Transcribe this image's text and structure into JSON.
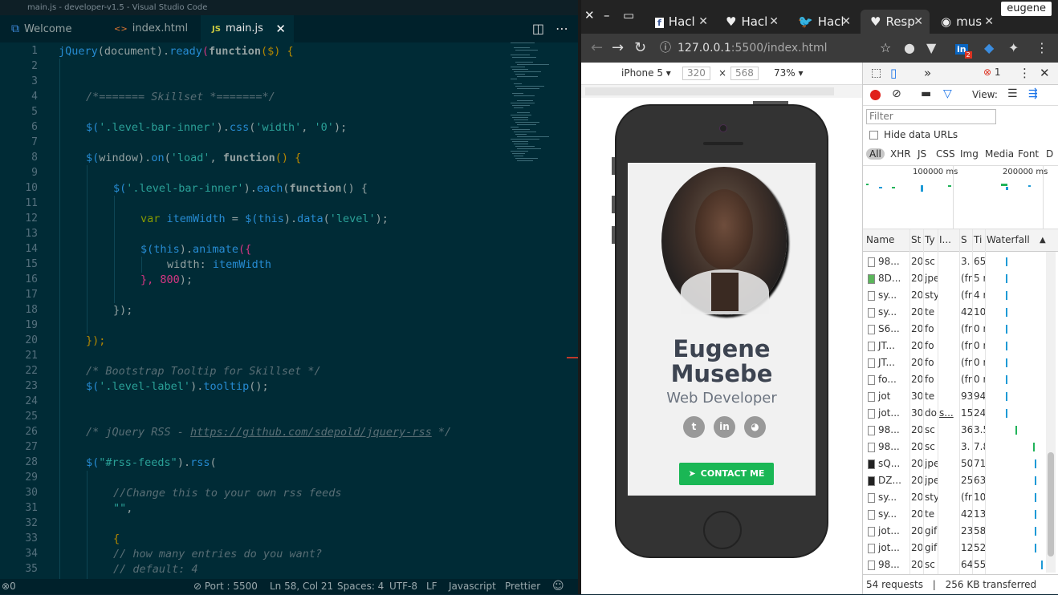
{
  "vscode": {
    "window_title": "main.js - developer-v1.5 - Visual Studio Code",
    "tabs": [
      {
        "label": "Welcome",
        "icon": "vscode-icon"
      },
      {
        "label": "index.html",
        "icon": "html-icon"
      },
      {
        "label": "main.js",
        "icon": "js-icon",
        "active": true
      }
    ],
    "line_numbers": [
      "1",
      "2",
      "3",
      "4",
      "5",
      "6",
      "7",
      "8",
      "9",
      "10",
      "11",
      "12",
      "13",
      "14",
      "15",
      "16",
      "17",
      "18",
      "19",
      "20",
      "21",
      "22",
      "23",
      "24",
      "25",
      "26",
      "27",
      "28",
      "29",
      "30",
      "31",
      "32",
      "33",
      "34",
      "35"
    ],
    "status": {
      "errors": "0",
      "port": "Port : 5500",
      "position": "Ln 58, Col 21",
      "spaces": "Spaces: 4",
      "encoding": "UTF-8",
      "eol": "LF",
      "language": "Javascript",
      "formatter": "Prettier"
    },
    "code": {
      "l1a": "jQuery",
      "l1b": "(document).",
      "l1c": "ready",
      "l1d": "(",
      "l1e": "function",
      "l1f": "($) {",
      "l4": "/*======= Skillset *=======*/",
      "l6a": "$(",
      "l6b": "'.level-bar-inner'",
      "l6c": ").",
      "l6d": "css",
      "l6e": "(",
      "l6f": "'width'",
      "l6g": ", ",
      "l6h": "'0'",
      "l6i": ");",
      "l8a": "$(",
      "l8b": "window",
      "l8c": ").",
      "l8d": "on",
      "l8e": "(",
      "l8f": "'load'",
      "l8g": ", ",
      "l8h": "function",
      "l8i": "() {",
      "l10a": "$(",
      "l10b": "'.level-bar-inner'",
      "l10c": ").",
      "l10d": "each",
      "l10e": "(",
      "l10f": "function",
      "l10g": "() {",
      "l12a": "var ",
      "l12b": "itemWidth",
      "l12c": " = ",
      "l12d": "$(",
      "l12e": "this",
      "l12f": ").",
      "l12g": "data",
      "l12h": "(",
      "l12i": "'level'",
      "l12j": ");",
      "l14a": "$(",
      "l14b": "this",
      "l14c": ").",
      "l14d": "animate",
      "l14e": "({",
      "l15a": "width: ",
      "l15b": "itemWidth",
      "l16a": "}, ",
      "l16b": "800",
      "l16c": ");",
      "l18": "});",
      "l20": "});",
      "l22": "/* Bootstrap Tooltip for Skillset */",
      "l23a": "$(",
      "l23b": "'.level-label'",
      "l23c": ").",
      "l23d": "tooltip",
      "l23e": "();",
      "l26a": "/* jQuery RSS - ",
      "l26b": "https://github.com/sdepold/jquery-rss",
      "l26c": " */",
      "l28a": "$(",
      "l28b": "\"#rss-feeds\"",
      "l28c": ").",
      "l28d": "rss",
      "l28e": "(",
      "l30": "//Change this to your own rss feeds",
      "l31a": "\"\"",
      "l31b": ",",
      "l33": "{",
      "l34": "// how many entries do you want?",
      "l35": "// default: 4"
    }
  },
  "chrome": {
    "profile": "eugene",
    "tabs": [
      {
        "label": "Hacl",
        "icon": "facebook-icon"
      },
      {
        "label": "Hacl",
        "icon": "heart-icon"
      },
      {
        "label": "Hacl",
        "icon": "twitter-icon"
      },
      {
        "label": "Resp",
        "icon": "heart-icon",
        "active": true
      },
      {
        "label": "mus",
        "icon": "github-icon"
      }
    ],
    "url_host": "127.0.0.1",
    "url_rest": ":5500/index.html",
    "extension_badge": "2",
    "device": {
      "name": "iPhone 5",
      "width": "320",
      "times": "×",
      "height": "568",
      "zoom": "73%"
    },
    "page": {
      "name_first": "Eugene",
      "name_last": "Musebe",
      "role": "Web Developer",
      "contact": "CONTACT ME"
    },
    "devtools": {
      "more_tabs": "»",
      "error_count": "1",
      "view_label": "View:",
      "filter_placeholder": "Filter",
      "hide_data_urls": "Hide data URLs",
      "types": [
        "All",
        "XHR",
        "JS",
        "CSS",
        "Img",
        "Media",
        "Font",
        "D"
      ],
      "overview_ticks": [
        "100000 ms",
        "200000 ms"
      ],
      "columns": [
        "Name",
        "St",
        "Ty",
        "I...",
        "S",
        "Ti",
        "Waterfall"
      ],
      "rows": [
        {
          "name": "98...",
          "status": "20",
          "type": "sc",
          "init": "",
          "size": "3.",
          "time": "65",
          "icon": "file"
        },
        {
          "name": "8D...",
          "status": "20",
          "type": "jpe",
          "init": "",
          "size": "(fr",
          "time": "5 r",
          "icon": "image"
        },
        {
          "name": "sy...",
          "status": "20",
          "type": "sty",
          "init": "",
          "size": "(fr",
          "time": "4 r",
          "icon": "file"
        },
        {
          "name": "sy...",
          "status": "20",
          "type": "te",
          "init": "",
          "size": "42",
          "time": "10",
          "icon": "file"
        },
        {
          "name": "S6...",
          "status": "20",
          "type": "fo",
          "init": "",
          "size": "(fr",
          "time": "0 r",
          "icon": "file"
        },
        {
          "name": "JT...",
          "status": "20",
          "type": "fo",
          "init": "",
          "size": "(fr",
          "time": "0 r",
          "icon": "file"
        },
        {
          "name": "JT...",
          "status": "20",
          "type": "fo",
          "init": "",
          "size": "(fr",
          "time": "0 r",
          "icon": "file"
        },
        {
          "name": "fo...",
          "status": "20",
          "type": "fo",
          "init": "",
          "size": "(fr",
          "time": "0 r",
          "icon": "file"
        },
        {
          "name": "jot",
          "status": "30",
          "type": "te",
          "init": "",
          "size": "93",
          "time": "94",
          "icon": "file"
        },
        {
          "name": "jot...",
          "status": "30",
          "type": "do",
          "init": "s...",
          "size": "15",
          "time": "24",
          "icon": "file"
        },
        {
          "name": "98...",
          "status": "20",
          "type": "sc",
          "init": "",
          "size": "36",
          "time": "3.5",
          "icon": "file"
        },
        {
          "name": "98...",
          "status": "20",
          "type": "sc",
          "init": "",
          "size": "3.",
          "time": "7.8",
          "icon": "file"
        },
        {
          "name": "sQ...",
          "status": "20",
          "type": "jpe",
          "init": "",
          "size": "50",
          "time": "71",
          "icon": "image-dark"
        },
        {
          "name": "DZ...",
          "status": "20",
          "type": "jpe",
          "init": "",
          "size": "25",
          "time": "63",
          "icon": "image-dark"
        },
        {
          "name": "sy...",
          "status": "20",
          "type": "sty",
          "init": "",
          "size": "(fr",
          "time": "10",
          "icon": "file"
        },
        {
          "name": "sy...",
          "status": "20",
          "type": "te",
          "init": "",
          "size": "42",
          "time": "13",
          "icon": "file"
        },
        {
          "name": "jot...",
          "status": "20",
          "type": "gif",
          "init": "",
          "size": "23",
          "time": "58",
          "icon": "file"
        },
        {
          "name": "jot...",
          "status": "20",
          "type": "gif",
          "init": "",
          "size": "12",
          "time": "52",
          "icon": "file"
        },
        {
          "name": "98...",
          "status": "20",
          "type": "sc",
          "init": "",
          "size": "64",
          "time": "55",
          "icon": "file"
        }
      ],
      "summary_requests": "54 requests",
      "summary_sep": "|",
      "summary_transferred": "256 KB transferred"
    }
  }
}
